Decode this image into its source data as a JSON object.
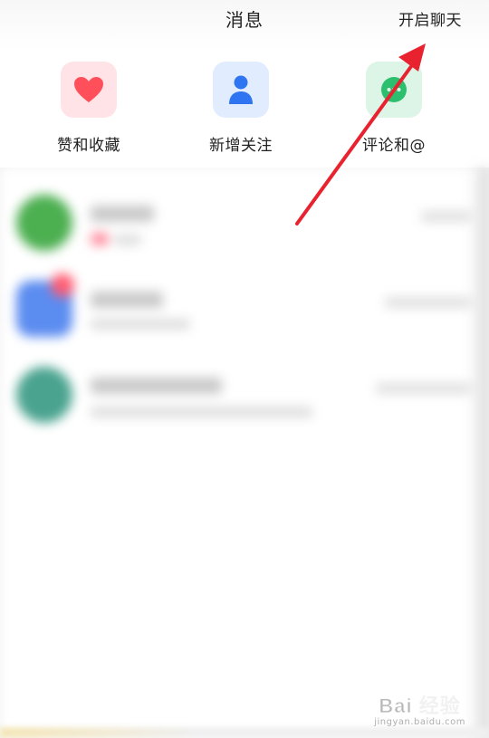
{
  "header": {
    "title": "消息",
    "start_chat_label": "开启聊天"
  },
  "shortcuts": [
    {
      "label": "赞和收藏",
      "icon": "heart-icon",
      "color": "#ff5a5f"
    },
    {
      "label": "新增关注",
      "icon": "person-icon",
      "color": "#3d7bf5"
    },
    {
      "label": "评论和@",
      "icon": "comment-icon",
      "color": "#2fbf71"
    }
  ],
  "annotation": {
    "arrow_color": "#e8232f",
    "arrow_target": "start-chat-button"
  },
  "watermark": {
    "brand": "Bai 经验",
    "domain": "jingyan.baidu.com"
  }
}
